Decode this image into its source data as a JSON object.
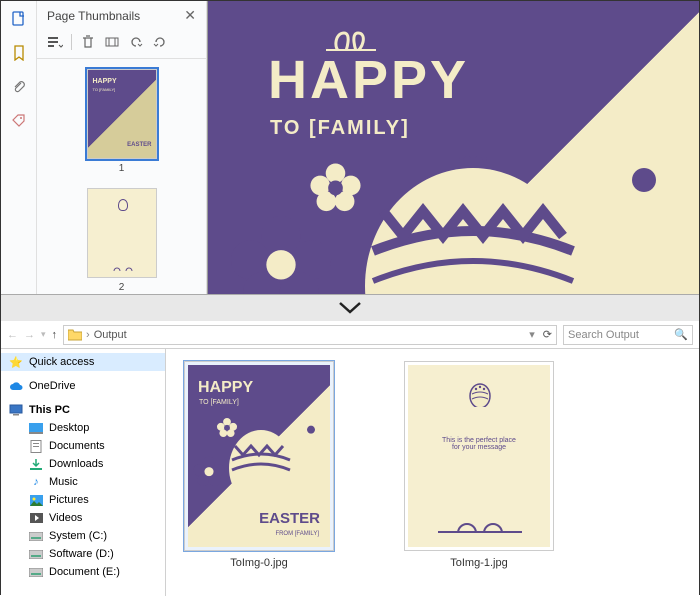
{
  "panel": {
    "title": "Page Thumbnails",
    "thumbs": [
      {
        "label": "1"
      },
      {
        "label": "2"
      }
    ]
  },
  "preview": {
    "headline": "HAPPY",
    "subline": "TO [FAMILY]"
  },
  "explorer": {
    "path_label": "Output",
    "search_placeholder": "Search Output",
    "tree": {
      "quick_access": "Quick access",
      "onedrive": "OneDrive",
      "this_pc": "This PC",
      "desktop": "Desktop",
      "documents": "Documents",
      "downloads": "Downloads",
      "music": "Music",
      "pictures": "Pictures",
      "videos": "Videos",
      "system": "System (C:)",
      "software": "Software (D:)",
      "document_e": "Document (E:)"
    },
    "files": [
      {
        "name": "ToImg-0.jpg"
      },
      {
        "name": "ToImg-1.jpg"
      }
    ],
    "file2_caption": "This is the perfect place\nfor your message"
  },
  "card": {
    "happy": "HAPPY",
    "to": "TO [FAMILY]",
    "easter": "EASTER",
    "from": "FROM [FAMILY]"
  }
}
